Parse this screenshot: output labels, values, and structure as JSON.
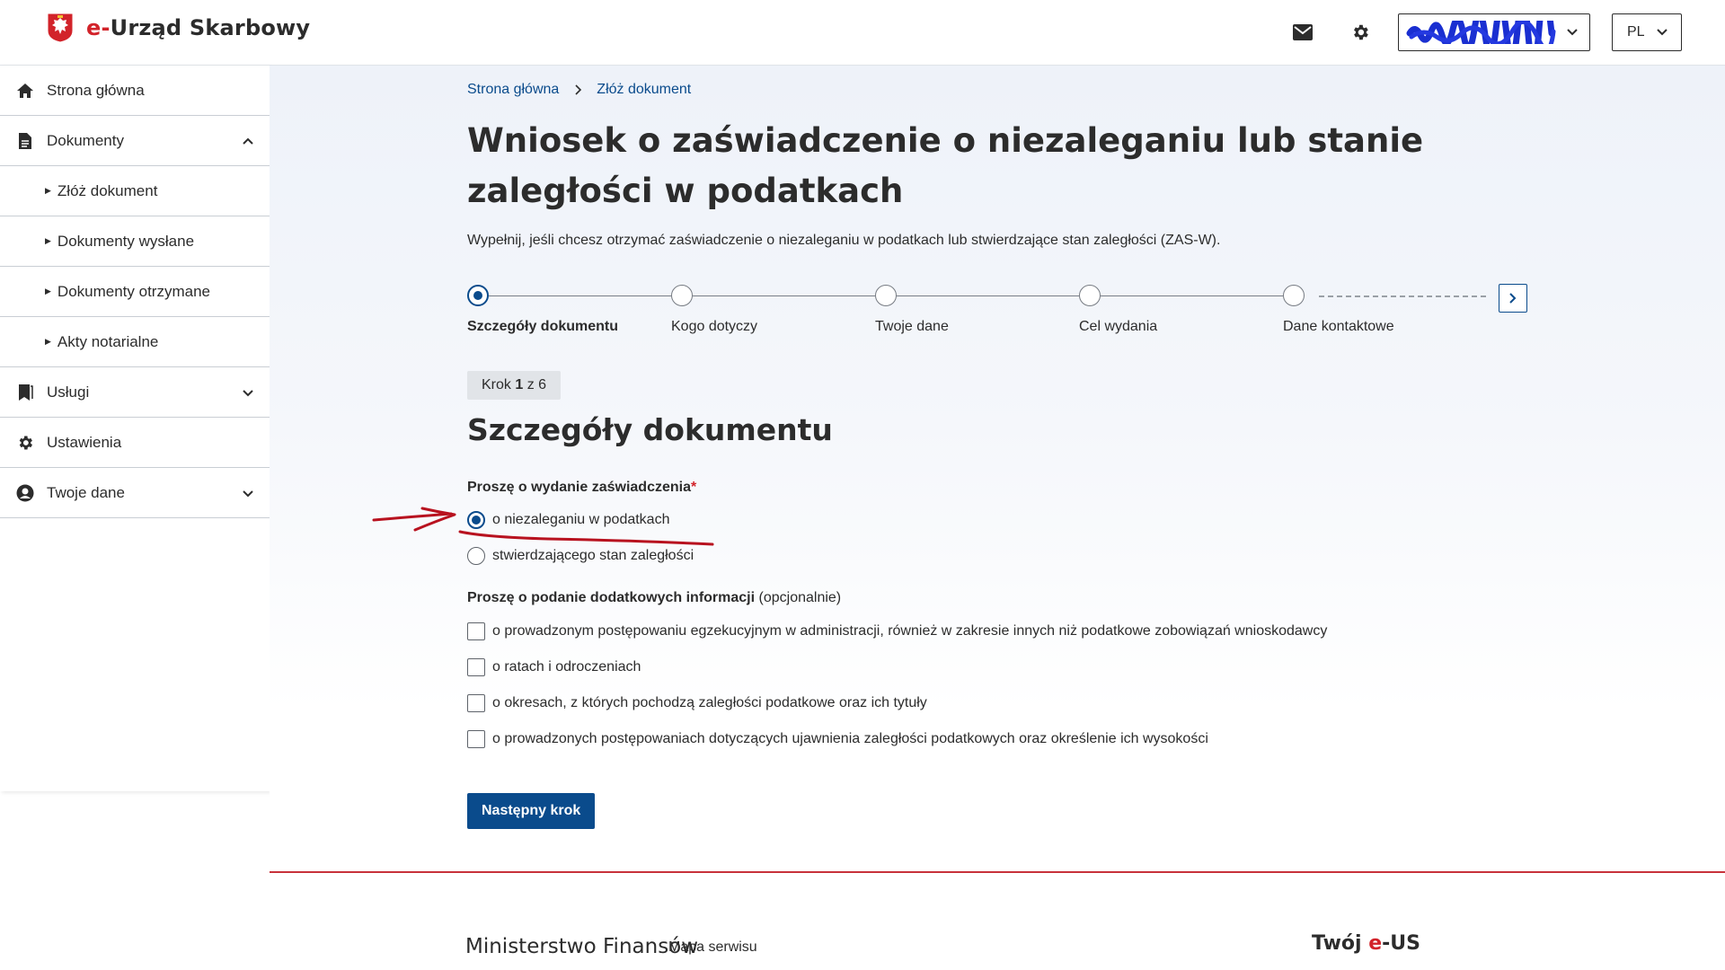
{
  "header": {
    "brand_prefix": "e-",
    "brand_name": "Urząd Skarbowy",
    "lang": "PL",
    "user_redacted": true,
    "icons": [
      "mail-icon",
      "gear-icon",
      "chevron-down-icon"
    ]
  },
  "sidebar": {
    "items": [
      {
        "label": "Strona główna",
        "icon": "home-icon"
      },
      {
        "label": "Dokumenty",
        "icon": "document-icon",
        "expanded": true
      },
      {
        "label": "Złóż dokument"
      },
      {
        "label": "Dokumenty wysłane"
      },
      {
        "label": "Dokumenty otrzymane"
      },
      {
        "label": "Akty notarialne"
      },
      {
        "label": "Usługi",
        "icon": "bookmark-icon"
      },
      {
        "label": "Ustawienia",
        "icon": "gear-icon"
      },
      {
        "label": "Twoje dane",
        "icon": "user-icon"
      }
    ]
  },
  "breadcrumb": {
    "home": "Strona główna",
    "current": "Złóż dokument"
  },
  "page": {
    "title": "Wniosek o zaświadczenie o niezaleganiu lub stanie zaległości w podatkach",
    "intro": "Wypełnij, jeśli chcesz otrzymać zaświadczenie o niezaleganiu w podatkach lub stwierdzające stan zaległości (ZAS-W)."
  },
  "stepper": {
    "steps": [
      {
        "label": "Szczegóły dokumentu",
        "active": true
      },
      {
        "label": "Kogo dotyczy"
      },
      {
        "label": "Twoje dane"
      },
      {
        "label": "Cel wydania"
      },
      {
        "label": "Dane kontaktowe"
      }
    ],
    "badge_prefix": "Krok ",
    "badge_current": "1",
    "badge_suffix": " z 6"
  },
  "form": {
    "section_title": "Szczegóły dokumentu",
    "radio_label": "Proszę o wydanie zaświadczenia",
    "required_mark": "*",
    "radio_options": [
      {
        "label": "o niezaleganiu w podatkach",
        "checked": true
      },
      {
        "label": "stwierdzającego stan zaległości",
        "checked": false
      }
    ],
    "checkbox_label": "Proszę o podanie dodatkowych informacji",
    "checkbox_label_optional": "(opcjonalnie)",
    "checkbox_options": [
      {
        "label": "o prowadzonym postępowaniu egzekucyjnym w administracji, również w zakresie innych niż podatkowe zobowiązań wnioskodawcy",
        "checked": false
      },
      {
        "label": "o ratach i odroczeniach",
        "checked": false
      },
      {
        "label": "o okresach, z których pochodzą zaległości podatkowe oraz ich tytuły",
        "checked": false
      },
      {
        "label": "o prowadzonych postępowaniach dotyczących ujawnienia zaległości podatkowych oraz określenie ich wysokości",
        "checked": false
      }
    ],
    "next_button": "Następny krok"
  },
  "footer": {
    "ministry": "Ministerstwo Finansów",
    "sitemap": "Mapa serwisu",
    "brand_prefix": "Twój ",
    "brand_accent": "e",
    "brand_suffix": "-US"
  },
  "colors": {
    "primary": "#0a4b8c",
    "accent_red": "#d2232a",
    "annotation_red": "#b8121f"
  }
}
